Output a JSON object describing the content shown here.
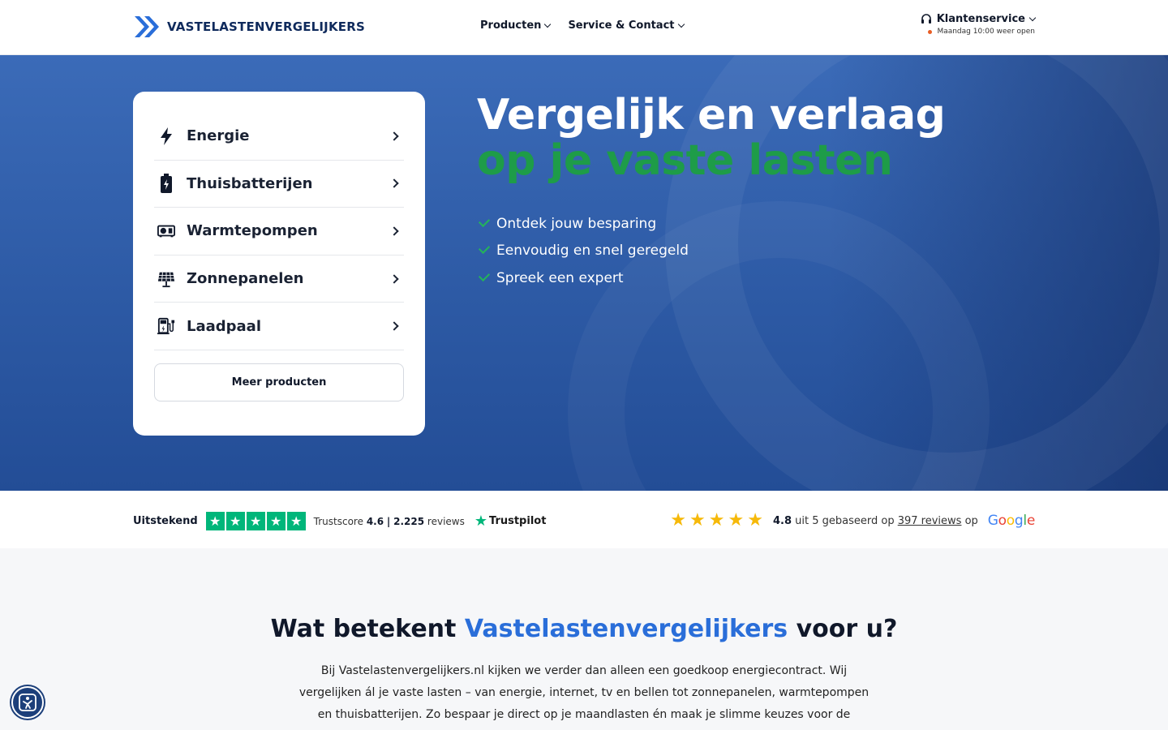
{
  "header": {
    "logo_text": "VASTELASTENVERGELIJKERS",
    "nav": [
      {
        "label": "Producten"
      },
      {
        "label": "Service & Contact"
      }
    ],
    "customer_service": {
      "label": "Klantenservice",
      "status": "Maandag 10:00 weer open"
    }
  },
  "hero": {
    "title_line1": "Vergelijk en verlaag",
    "title_line2": "op je vaste lasten",
    "checks": [
      "Ontdek jouw besparing",
      "Eenvoudig en snel geregeld",
      "Spreek een expert"
    ],
    "products": [
      {
        "label": "Energie",
        "icon": "lightning-icon"
      },
      {
        "label": "Thuisbatterijen",
        "icon": "battery-icon"
      },
      {
        "label": "Warmtepompen",
        "icon": "heat-pump-icon"
      },
      {
        "label": "Zonnepanelen",
        "icon": "solar-panel-icon"
      },
      {
        "label": "Laadpaal",
        "icon": "charging-station-icon"
      }
    ],
    "more_button": "Meer producten"
  },
  "reviews": {
    "trustpilot": {
      "rating_word": "Uitstekend",
      "score_label": "Trustscore",
      "score": "4.6",
      "separator": "|",
      "count": "2.225",
      "count_label": "reviews",
      "brand": "Trustpilot",
      "stars": 5
    },
    "google": {
      "score": "4.8",
      "text_mid": "uit 5 gebaseerd op",
      "link": "397 reviews",
      "text_end": "op",
      "brand": "Google",
      "stars": 5
    }
  },
  "section": {
    "title_pre": "Wat betekent",
    "title_highlight": "Vastelastenvergelijkers",
    "title_post": "voor u?",
    "paragraph": "Bij Vastelastenvergelijkers.nl kijken we verder dan alleen een goedkoop energiecontract. Wij vergelijken ál je vaste lasten – van energie, internet, tv en bellen tot zonnepanelen, warmtepompen en thuisbatterijen. Zo bespaar je direct op je maandlasten én maak je slimme keuzes voor de toekomst. Heb je"
  },
  "colors": {
    "brand_blue": "#2a6ed9",
    "hero_green": "#1e9c48",
    "trustpilot_green": "#00b67a",
    "google_star": "#f6b90a"
  }
}
